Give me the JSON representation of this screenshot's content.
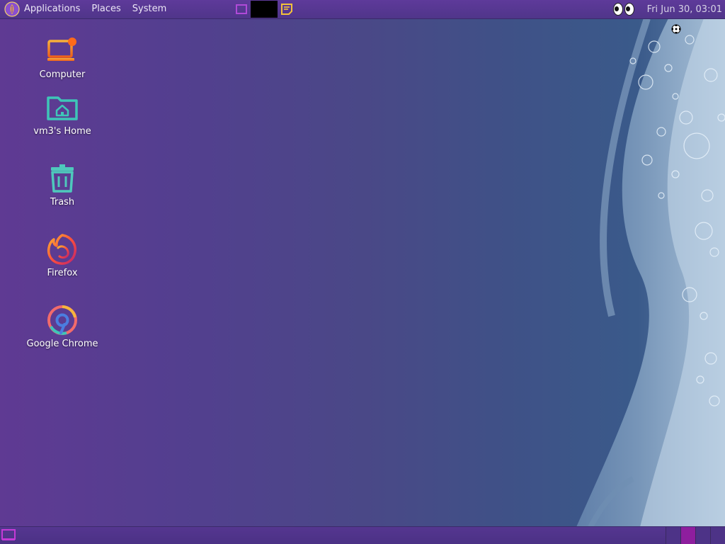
{
  "top_panel": {
    "menus": {
      "applications": "Applications",
      "places": "Places",
      "system": "System"
    },
    "clock": "Fri Jun 30, 03:01"
  },
  "desktop": {
    "icons": [
      {
        "label": "Computer",
        "icon": "computer-icon"
      },
      {
        "label": "vm3's Home",
        "icon": "home-folder-icon"
      },
      {
        "label": "Trash",
        "icon": "trash-icon"
      },
      {
        "label": "Firefox",
        "icon": "firefox-icon"
      },
      {
        "label": "Google Chrome",
        "icon": "chrome-icon"
      }
    ]
  },
  "colors": {
    "panel": "#5a3a95",
    "accent_orange": "#f07a1e",
    "accent_teal": "#3ec6b8",
    "active_workspace": "#8e1e9e"
  }
}
